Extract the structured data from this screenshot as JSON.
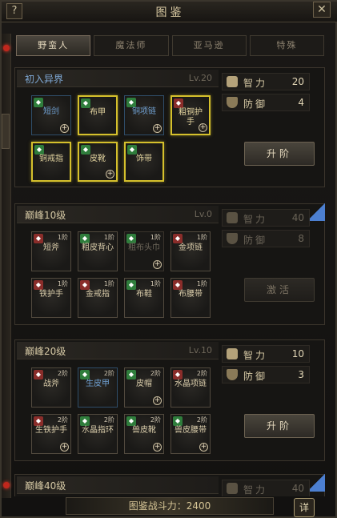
{
  "window": {
    "title": "图鉴",
    "help": "?",
    "close": "✕"
  },
  "tabs": [
    {
      "label": "野蛮人",
      "active": true
    },
    {
      "label": "魔法师",
      "active": false
    },
    {
      "label": "亚马逊",
      "active": false
    },
    {
      "label": "特殊",
      "active": false
    }
  ],
  "sections": [
    {
      "name": "初入异界",
      "level": "Lv.20",
      "items": [
        {
          "label": "短剑",
          "rank": "",
          "plus": true
        },
        {
          "label": "布甲",
          "rank": "",
          "plus": false
        },
        {
          "label": "铜项链",
          "rank": "",
          "plus": true
        },
        {
          "label": "粗铜护手",
          "rank": "",
          "plus": true
        },
        {
          "label": "铜戒指",
          "rank": "",
          "plus": false
        },
        {
          "label": "皮靴",
          "rank": "",
          "plus": true
        },
        {
          "label": "饰带",
          "rank": "",
          "plus": false
        }
      ],
      "stats": [
        {
          "name": "智力",
          "value": "20"
        },
        {
          "name": "防御",
          "value": "4"
        }
      ],
      "button": "升阶"
    },
    {
      "name": "巅峰10级",
      "level": "Lv.0",
      "items": [
        {
          "label": "短斧",
          "rank": "1阶"
        },
        {
          "label": "粗皮背心",
          "rank": "1阶"
        },
        {
          "label": "粗布头巾",
          "rank": "1阶"
        },
        {
          "label": "金项链",
          "rank": "1阶"
        },
        {
          "label": "铁护手",
          "rank": "1阶"
        },
        {
          "label": "金戒指",
          "rank": "1阶"
        },
        {
          "label": "布鞋",
          "rank": "1阶"
        },
        {
          "label": "布腰带",
          "rank": "1阶"
        }
      ],
      "stats": [
        {
          "name": "智力",
          "value": "40"
        },
        {
          "name": "防御",
          "value": "8"
        }
      ],
      "button": "激活"
    },
    {
      "name": "巅峰20级",
      "level": "Lv.10",
      "items": [
        {
          "label": "战斧",
          "rank": "2阶"
        },
        {
          "label": "生皮甲",
          "rank": "2阶"
        },
        {
          "label": "皮帽",
          "rank": "2阶"
        },
        {
          "label": "水晶项链",
          "rank": "2阶"
        },
        {
          "label": "生铁护手",
          "rank": "2阶"
        },
        {
          "label": "水晶指环",
          "rank": "2阶"
        },
        {
          "label": "兽皮靴",
          "rank": "2阶"
        },
        {
          "label": "兽皮腰带",
          "rank": "2阶"
        }
      ],
      "stats": [
        {
          "name": "智力",
          "value": "10"
        },
        {
          "name": "防御",
          "value": "3"
        }
      ],
      "button": "升阶"
    },
    {
      "name": "巅峰40级",
      "level": "",
      "stats": [
        {
          "name": "智力",
          "value": "40"
        }
      ]
    }
  ],
  "footer": {
    "power": "图鉴战斗力：2400",
    "detail": "详"
  },
  "colors": {
    "gold_border": "#d5c02c",
    "blue_ribbon": "#4c7fd0",
    "red_badge": "#8a2d2a",
    "green_badge": "#2f7d3c"
  }
}
